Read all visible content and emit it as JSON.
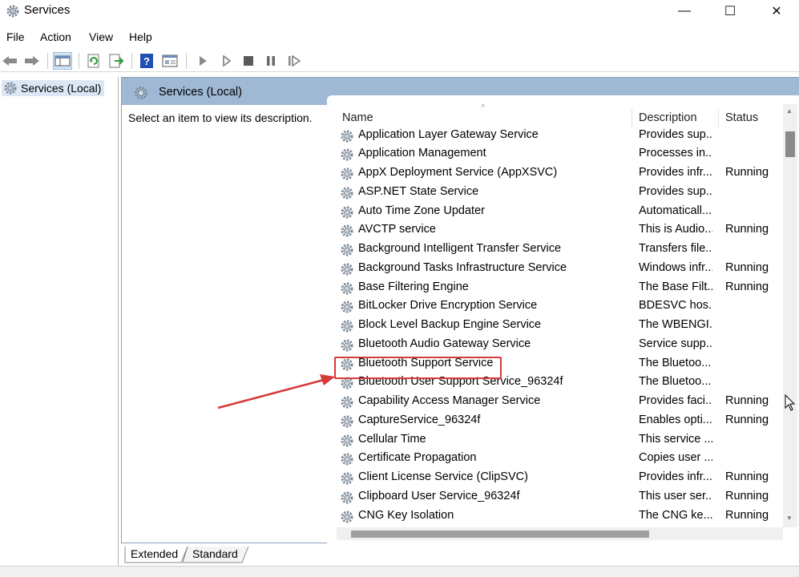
{
  "window": {
    "title": "Services",
    "minimize": "—",
    "maximize": "☐",
    "close": "✕"
  },
  "menu": [
    "File",
    "Action",
    "View",
    "Help"
  ],
  "tree": {
    "root": "Services (Local)"
  },
  "panel": {
    "title": "Services (Local)",
    "description_prompt": "Select an item to view its description."
  },
  "columns": {
    "name": "Name",
    "description": "Description",
    "status": "Status"
  },
  "services": [
    {
      "name": "Application Layer Gateway Service",
      "description": "Provides sup...",
      "status": ""
    },
    {
      "name": "Application Management",
      "description": "Processes in...",
      "status": ""
    },
    {
      "name": "AppX Deployment Service (AppXSVC)",
      "description": "Provides infr...",
      "status": "Running"
    },
    {
      "name": "ASP.NET State Service",
      "description": "Provides sup...",
      "status": ""
    },
    {
      "name": "Auto Time Zone Updater",
      "description": "Automaticall...",
      "status": ""
    },
    {
      "name": "AVCTP service",
      "description": "This is Audio...",
      "status": "Running"
    },
    {
      "name": "Background Intelligent Transfer Service",
      "description": "Transfers file...",
      "status": ""
    },
    {
      "name": "Background Tasks Infrastructure Service",
      "description": "Windows infr...",
      "status": "Running"
    },
    {
      "name": "Base Filtering Engine",
      "description": "The Base Filt...",
      "status": "Running"
    },
    {
      "name": "BitLocker Drive Encryption Service",
      "description": "BDESVC hos...",
      "status": ""
    },
    {
      "name": "Block Level Backup Engine Service",
      "description": "The WBENGI...",
      "status": ""
    },
    {
      "name": "Bluetooth Audio Gateway Service",
      "description": "Service supp...",
      "status": ""
    },
    {
      "name": "Bluetooth Support Service",
      "description": "The Bluetoo...",
      "status": ""
    },
    {
      "name": "Bluetooth User Support Service_96324f",
      "description": "The Bluetoo...",
      "status": ""
    },
    {
      "name": "Capability Access Manager Service",
      "description": "Provides faci...",
      "status": "Running"
    },
    {
      "name": "CaptureService_96324f",
      "description": "Enables opti...",
      "status": "Running"
    },
    {
      "name": "Cellular Time",
      "description": "This service ...",
      "status": ""
    },
    {
      "name": "Certificate Propagation",
      "description": "Copies user ...",
      "status": ""
    },
    {
      "name": "Client License Service (ClipSVC)",
      "description": "Provides infr...",
      "status": "Running"
    },
    {
      "name": "Clipboard User Service_96324f",
      "description": "This user ser...",
      "status": "Running"
    },
    {
      "name": "CNG Key Isolation",
      "description": "The CNG ke...",
      "status": "Running"
    }
  ],
  "tabs": [
    "Extended",
    "Standard"
  ],
  "colors": {
    "header_bar": "#9fb8d3",
    "highlight": "#d63a3a",
    "selected_tree": "#dbe7f4"
  }
}
